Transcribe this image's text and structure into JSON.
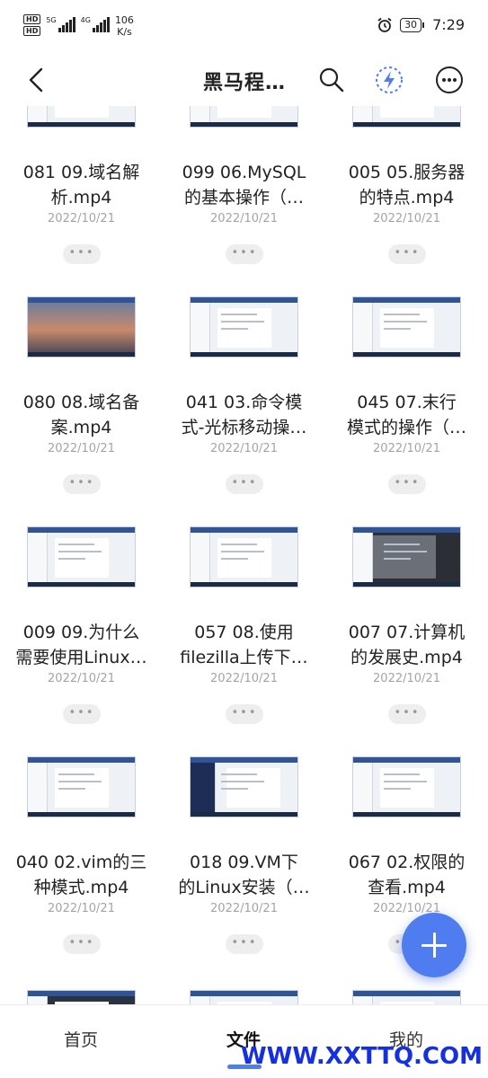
{
  "status_bar": {
    "sim1": "HD",
    "sim2": "HD",
    "net1": "5G",
    "net2": "4G",
    "speed_value": "106",
    "speed_unit": "K/s",
    "battery": "30",
    "time": "7:29"
  },
  "title_bar": {
    "title": "黑马程…"
  },
  "files": [
    {
      "title1": "081 09.域名解",
      "title2": "析.mp4",
      "date": "2022/10/21",
      "thumb": "doc"
    },
    {
      "title1": "099 06.MySQL",
      "title2": "的基本操作（…",
      "date": "2022/10/21",
      "thumb": "doc"
    },
    {
      "title1": "005 05.服务器",
      "title2": "的特点.mp4",
      "date": "2022/10/21",
      "thumb": "doc"
    },
    {
      "title1": "080 08.域名备",
      "title2": "案.mp4",
      "date": "2022/10/21",
      "thumb": "landscape"
    },
    {
      "title1": "041 03.命令模",
      "title2": "式-光标移动操…",
      "date": "2022/10/21",
      "thumb": "doc"
    },
    {
      "title1": "045 07.末行",
      "title2": "模式的操作（…",
      "date": "2022/10/21",
      "thumb": "doc"
    },
    {
      "title1": "009 09.为什么",
      "title2": "需要使用Linux…",
      "date": "2022/10/21",
      "thumb": "doc"
    },
    {
      "title1": "057 08.使用",
      "title2": "filezilla上传下…",
      "date": "2022/10/21",
      "thumb": "doc"
    },
    {
      "title1": "007 07.计算机",
      "title2": "的发展史.mp4",
      "date": "2022/10/21",
      "thumb": "dark"
    },
    {
      "title1": "040 02.vim的三",
      "title2": "种模式.mp4",
      "date": "2022/10/21",
      "thumb": "doc"
    },
    {
      "title1": "018 09.VM下",
      "title2": "的Linux安装（…",
      "date": "2022/10/21",
      "thumb": "navy"
    },
    {
      "title1": "067 02.权限的",
      "title2": "查看.mp4",
      "date": "2022/10/21",
      "thumb": "doc"
    }
  ],
  "more_label": "•••",
  "bottom_nav": {
    "home": "首页",
    "files": "文件",
    "mine": "我的"
  },
  "watermark": "WWW.XXTTQ.COM",
  "colors": {
    "accent": "#4f7df0",
    "date_gray": "#a4a4a4",
    "watermark_blue": "#1430e0"
  }
}
